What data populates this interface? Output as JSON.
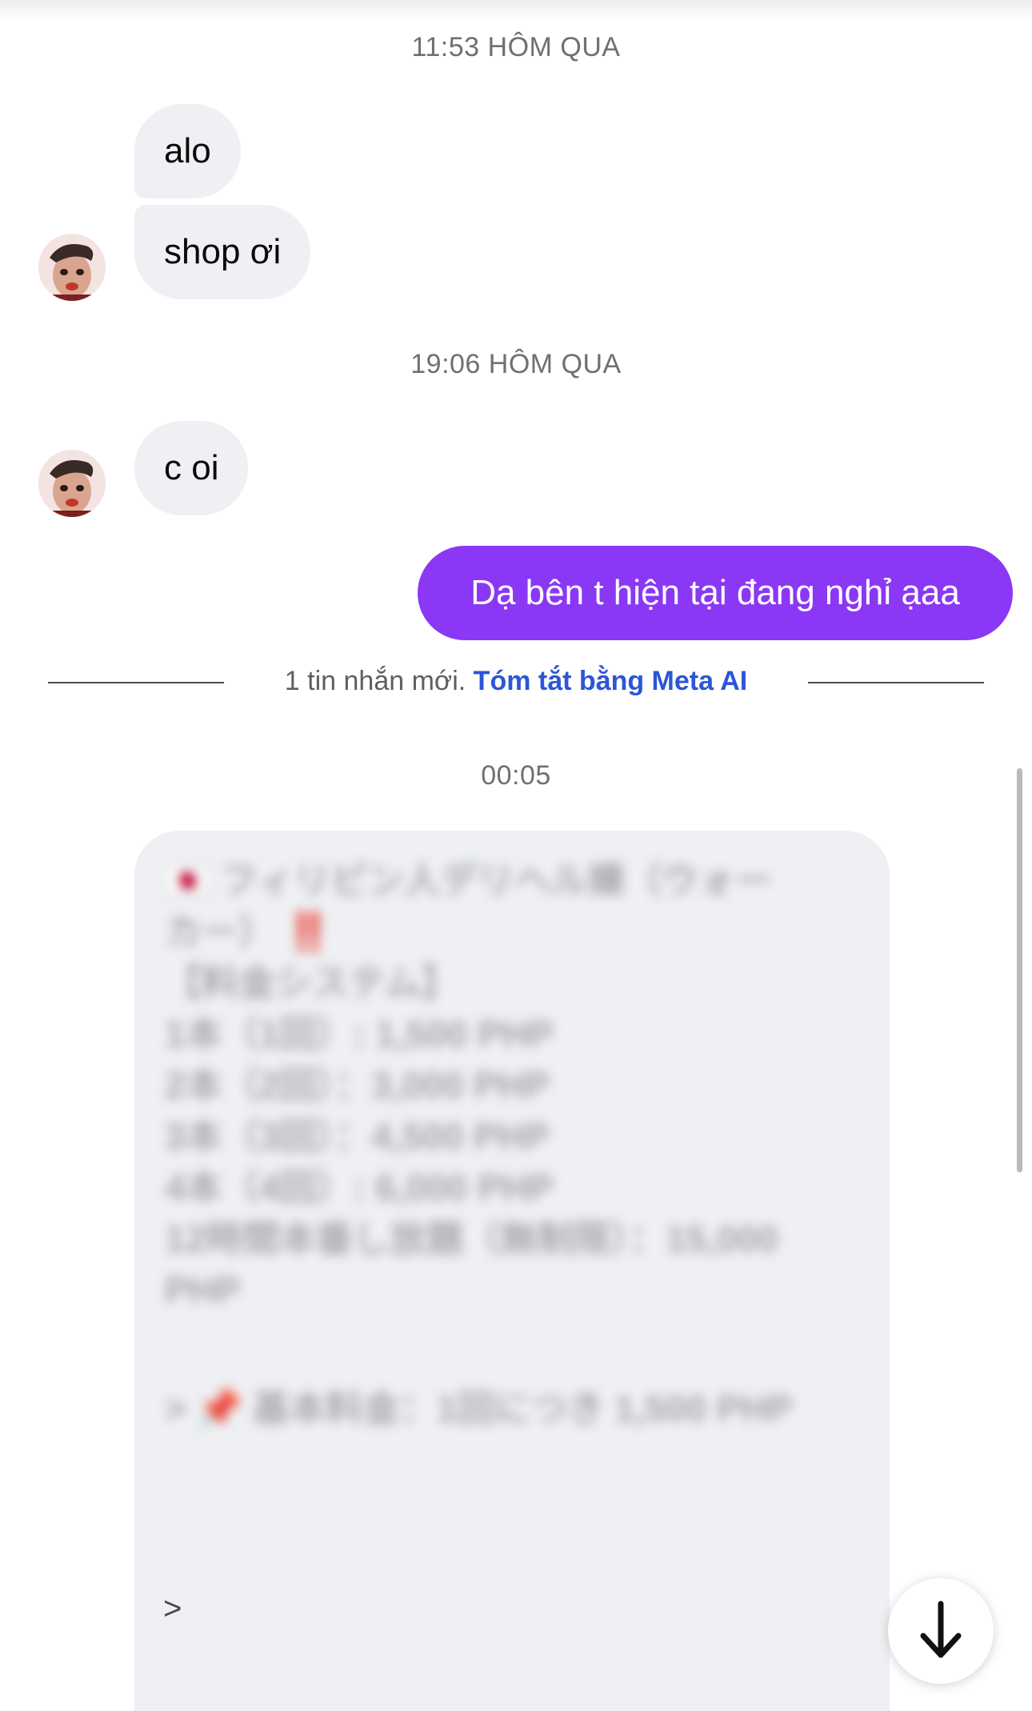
{
  "conversation": {
    "groups": [
      {
        "timestamp": "11:53 HÔM QUA",
        "messages": [
          "alo",
          "shop ơi"
        ]
      },
      {
        "timestamp": "19:06 HÔM QUA",
        "messages": [
          "c oi"
        ]
      }
    ],
    "outgoing_message": "Dạ bên t hiện tại đang nghỉ ạaa",
    "new_messages_notice": "1 tin nhắn mới.",
    "summarize_link": "Tóm tắt bằng Meta AI",
    "latest_timestamp": "00:05",
    "blurred_card": {
      "line1": "🇯🇵 フィリピン人デリヘル嬢（ウォー",
      "line2": "カー）",
      "line2_mark": "‼️",
      "line3": "【料金システム】",
      "line4": "1本（1回）: 1,500 PHP",
      "line5": "2本（2回）：3,000 PHP",
      "line6": "3本（3回）：4,500 PHP",
      "line7": "4本（4回）: 6,000 PHP",
      "line8": "12時間本番し放題（無制限）：15,000",
      "line9": "PHP",
      "line10": "> 📌 基本料金：1回につき 1,500 PHP",
      "caret": ">"
    }
  },
  "icons": {
    "scroll_down": "arrow-down-icon",
    "avatar": "sender-avatar"
  },
  "colors": {
    "outgoing_bubble": "#8a38f5",
    "incoming_bubble": "#eef0f3",
    "link": "#2c56d6"
  }
}
